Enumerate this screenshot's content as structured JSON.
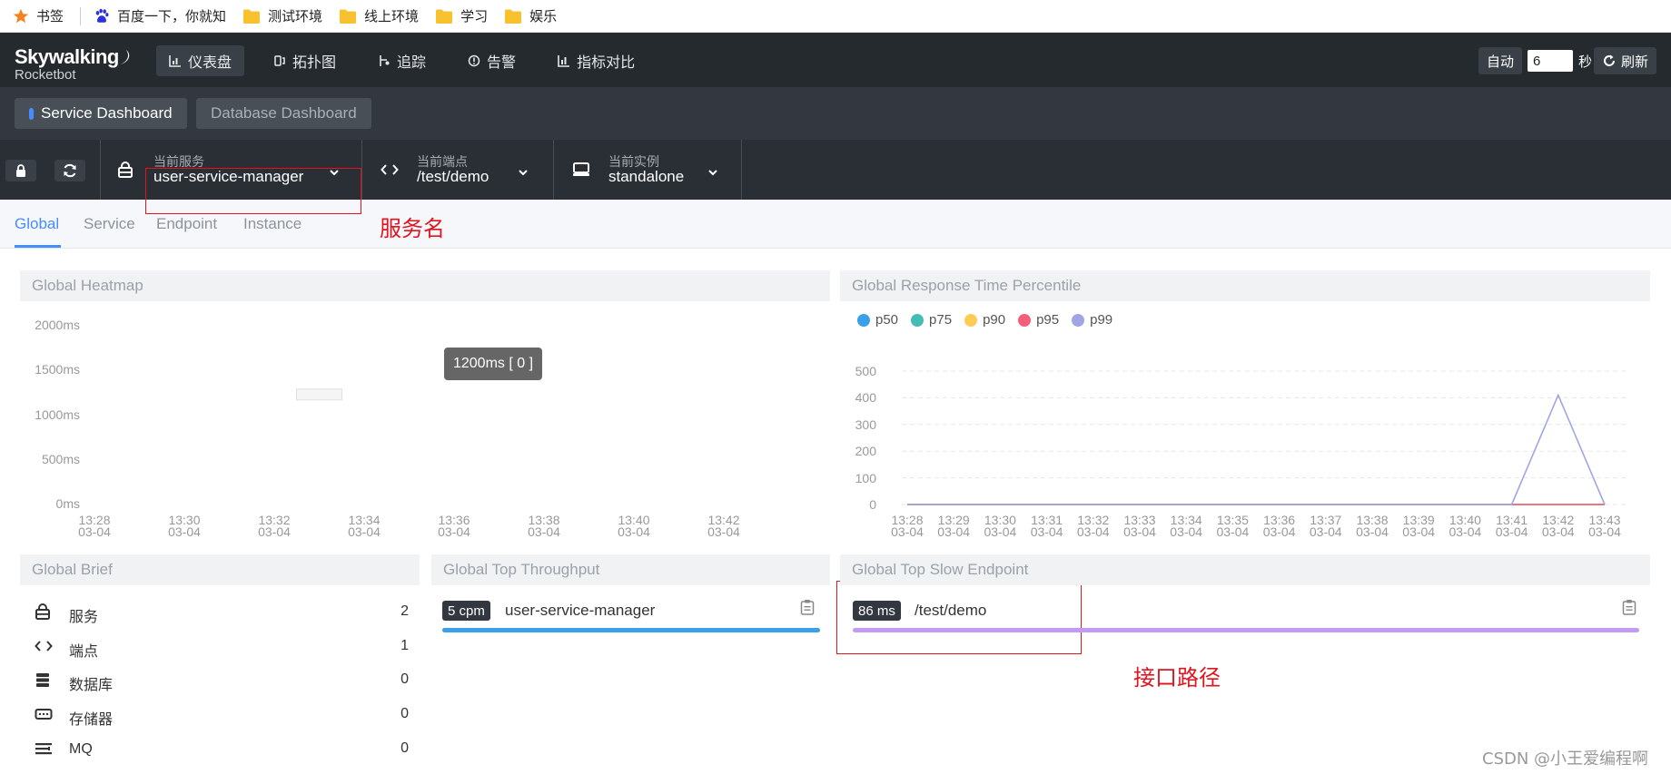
{
  "bookmarks": [
    {
      "label": "书签",
      "icon": "star-icon"
    },
    {
      "label": "百度一下，你就知",
      "icon": "baidu-paw-icon"
    },
    {
      "label": "测试环境",
      "icon": "folder-icon"
    },
    {
      "label": "线上环境",
      "icon": "folder-icon"
    },
    {
      "label": "学习",
      "icon": "folder-icon"
    },
    {
      "label": "娱乐",
      "icon": "folder-icon"
    }
  ],
  "app": {
    "name": "Skywalking",
    "sub": "Rocketbot"
  },
  "nav": {
    "items": [
      {
        "label": "仪表盘",
        "icon": "dashboard-icon",
        "active": true
      },
      {
        "label": "拓扑图",
        "icon": "topology-icon",
        "active": false
      },
      {
        "label": "追踪",
        "icon": "trace-icon",
        "active": false
      },
      {
        "label": "告警",
        "icon": "alarm-icon",
        "active": false
      },
      {
        "label": "指标对比",
        "icon": "compare-icon",
        "active": false
      }
    ],
    "auto": "自动",
    "interval": "6",
    "seconds": "秒",
    "refresh": "刷新"
  },
  "dashboards": {
    "active": "Service Dashboard",
    "other": "Database Dashboard"
  },
  "selectors": {
    "service": {
      "caption": "当前服务",
      "value": "user-service-manager"
    },
    "endpoint": {
      "caption": "当前端点",
      "value": "/test/demo"
    },
    "instance": {
      "caption": "当前实例",
      "value": "standalone"
    }
  },
  "annotations": {
    "service_name": "服务名",
    "endpoint_path": "接口路径"
  },
  "tabs": [
    "Global",
    "Service",
    "Endpoint",
    "Instance"
  ],
  "heatmap": {
    "title": "Global Heatmap",
    "y_ticks": [
      "2000ms",
      "1500ms",
      "1000ms",
      "500ms",
      "0ms"
    ],
    "x_ticks": [
      {
        "time": "13:28",
        "date": "03-04"
      },
      {
        "time": "13:30",
        "date": "03-04"
      },
      {
        "time": "13:32",
        "date": "03-04"
      },
      {
        "time": "13:34",
        "date": "03-04"
      },
      {
        "time": "13:36",
        "date": "03-04"
      },
      {
        "time": "13:38",
        "date": "03-04"
      },
      {
        "time": "13:40",
        "date": "03-04"
      },
      {
        "time": "13:42",
        "date": "03-04"
      }
    ],
    "tooltip": "1200ms [ 0 ]"
  },
  "percentile": {
    "title": "Global Response Time Percentile",
    "legend": [
      {
        "name": "p50",
        "color": "#3aa0e9"
      },
      {
        "name": "p75",
        "color": "#42bcb5"
      },
      {
        "name": "p90",
        "color": "#ffcc55"
      },
      {
        "name": "p95",
        "color": "#f35f7b"
      },
      {
        "name": "p99",
        "color": "#a1a5e6"
      }
    ]
  },
  "chart_data": [
    {
      "type": "heatmap",
      "title": "Global Heatmap",
      "x": [
        "13:28",
        "13:30",
        "13:32",
        "13:34",
        "13:36",
        "13:38",
        "13:40",
        "13:42"
      ],
      "ylim": [
        0,
        2000
      ],
      "y_unit": "ms",
      "cells": [
        {
          "x": "13:33",
          "y": 1200,
          "value": 0
        }
      ]
    },
    {
      "type": "line",
      "title": "Global Response Time Percentile",
      "categories": [
        "13:28",
        "13:29",
        "13:30",
        "13:31",
        "13:32",
        "13:33",
        "13:34",
        "13:35",
        "13:36",
        "13:37",
        "13:38",
        "13:39",
        "13:40",
        "13:41",
        "13:42",
        "13:43"
      ],
      "date": "03-04",
      "ylim": [
        0,
        500
      ],
      "y_ticks": [
        0,
        100,
        200,
        300,
        400,
        500
      ],
      "series": [
        {
          "name": "p50",
          "values": [
            0,
            0,
            0,
            0,
            0,
            0,
            0,
            0,
            0,
            0,
            0,
            0,
            0,
            0,
            0,
            0
          ]
        },
        {
          "name": "p75",
          "values": [
            0,
            0,
            0,
            0,
            0,
            0,
            0,
            0,
            0,
            0,
            0,
            0,
            0,
            0,
            0,
            0
          ]
        },
        {
          "name": "p90",
          "values": [
            0,
            0,
            0,
            0,
            0,
            0,
            0,
            0,
            0,
            0,
            0,
            0,
            0,
            0,
            0,
            0
          ]
        },
        {
          "name": "p95",
          "values": [
            0,
            0,
            0,
            0,
            0,
            0,
            0,
            0,
            0,
            0,
            0,
            0,
            0,
            0,
            0,
            0
          ]
        },
        {
          "name": "p99",
          "values": [
            0,
            0,
            0,
            0,
            0,
            0,
            0,
            0,
            0,
            0,
            0,
            0,
            0,
            0,
            410,
            0
          ]
        }
      ]
    }
  ],
  "brief": {
    "title": "Global Brief",
    "rows": [
      {
        "label": "服务",
        "value": "2",
        "icon": "service-icon"
      },
      {
        "label": "端点",
        "value": "1",
        "icon": "endpoint-icon"
      },
      {
        "label": "数据库",
        "value": "0",
        "icon": "database-icon"
      },
      {
        "label": "存储器",
        "value": "0",
        "icon": "cache-icon"
      },
      {
        "label": "MQ",
        "value": "0",
        "icon": "mq-icon"
      }
    ]
  },
  "throughput": {
    "title": "Global Top Throughput",
    "items": [
      {
        "badge": "5 cpm",
        "name": "user-service-manager",
        "color": "#3aa0e9"
      }
    ]
  },
  "slow": {
    "title": "Global Top Slow Endpoint",
    "items": [
      {
        "badge": "86 ms",
        "name": "/test/demo",
        "color": "#c39cf2"
      }
    ]
  },
  "watermark": "CSDN @小王爱编程啊"
}
